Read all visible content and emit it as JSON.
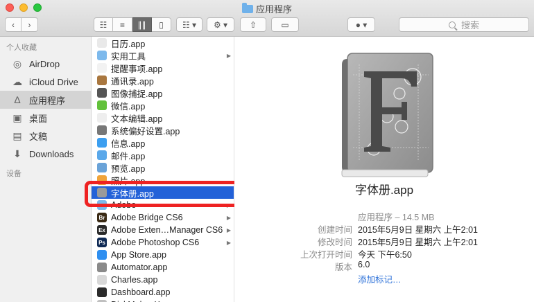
{
  "window": {
    "title": "应用程序"
  },
  "toolbar": {
    "back_icon": "chevron-left-icon",
    "forward_icon": "chevron-right-icon",
    "view_icons": [
      "icon-view-icon",
      "list-view-icon",
      "column-view-icon",
      "coverflow-view-icon"
    ],
    "arrange_icon": "arrange-grid-icon",
    "action_icon": "gear-icon",
    "share_icon": "share-icon",
    "tag_icon": "tag-icon",
    "dropdown_icon": "quicklook-icon",
    "search_placeholder": "搜索"
  },
  "sidebar": {
    "favorites_header": "个人收藏",
    "devices_header": "设备",
    "items": [
      {
        "label": "AirDrop",
        "icon": "airdrop-icon"
      },
      {
        "label": "iCloud Drive",
        "icon": "cloud-icon"
      },
      {
        "label": "应用程序",
        "icon": "applications-icon",
        "selected": true
      },
      {
        "label": "桌面",
        "icon": "desktop-icon"
      },
      {
        "label": "文稿",
        "icon": "documents-icon"
      },
      {
        "label": "Downloads",
        "icon": "downloads-icon"
      }
    ]
  },
  "files": [
    {
      "label": "日历.app",
      "icon": "calendar-icon",
      "color": "#e9e9e9"
    },
    {
      "label": "实用工具",
      "icon": "folder-icon",
      "color": "#7db9ec",
      "folder": true
    },
    {
      "label": "提醒事项.app",
      "icon": "reminders-icon",
      "color": "#f2f2f2"
    },
    {
      "label": "通讯录.app",
      "icon": "contacts-icon",
      "color": "#a9773f"
    },
    {
      "label": "图像捕捉.app",
      "icon": "image-capture-icon",
      "color": "#555555"
    },
    {
      "label": "微信.app",
      "icon": "wechat-icon",
      "color": "#62c13b"
    },
    {
      "label": "文本编辑.app",
      "icon": "textedit-icon",
      "color": "#eeeeee"
    },
    {
      "label": "系统偏好设置.app",
      "icon": "system-prefs-icon",
      "color": "#777777"
    },
    {
      "label": "信息.app",
      "icon": "messages-icon",
      "color": "#3c9ff0"
    },
    {
      "label": "邮件.app",
      "icon": "mail-icon",
      "color": "#5aa8ea"
    },
    {
      "label": "预览.app",
      "icon": "preview-icon",
      "color": "#6aa3d8"
    },
    {
      "label": "照片.app",
      "icon": "photos-icon",
      "color": "#f0a43a"
    },
    {
      "label": "字体册.app",
      "icon": "fontbook-icon",
      "color": "#9a9a9a",
      "selected": true
    },
    {
      "label": "Adobe",
      "icon": "folder-icon",
      "color": "#7db9ec",
      "folder": true
    },
    {
      "label": "Adobe Bridge CS6",
      "icon": "bridge-icon",
      "color": "#3a2a14",
      "tag": "Br",
      "folder": true
    },
    {
      "label": "Adobe Exten…Manager CS6",
      "icon": "extension-manager-icon",
      "color": "#2a2a2a",
      "tag": "Ex",
      "folder": true
    },
    {
      "label": "Adobe Photoshop CS6",
      "icon": "photoshop-icon",
      "color": "#0f2a55",
      "tag": "Ps",
      "folder": true
    },
    {
      "label": "App Store.app",
      "icon": "appstore-icon",
      "color": "#2f8ff0"
    },
    {
      "label": "Automator.app",
      "icon": "automator-icon",
      "color": "#8a8a8a"
    },
    {
      "label": "Charles.app",
      "icon": "charles-icon",
      "color": "#d8d8d8"
    },
    {
      "label": "Dashboard.app",
      "icon": "dashboard-icon",
      "color": "#2b2b2b"
    },
    {
      "label": "DiskMaker X.app",
      "icon": "app-icon",
      "color": "#c0c0c0"
    }
  ],
  "preview": {
    "name": "字体册.app",
    "subtitle": "应用程序 – 14.5 MB",
    "rows": [
      {
        "key": "创建时间",
        "value": "2015年5月9日 星期六 上午2:01"
      },
      {
        "key": "修改时间",
        "value": "2015年5月9日 星期六 上午2:01"
      },
      {
        "key": "上次打开时间",
        "value": "今天 下午6:50"
      },
      {
        "key": "版本",
        "value": "6.0"
      }
    ],
    "add_tags": "添加标记…"
  }
}
